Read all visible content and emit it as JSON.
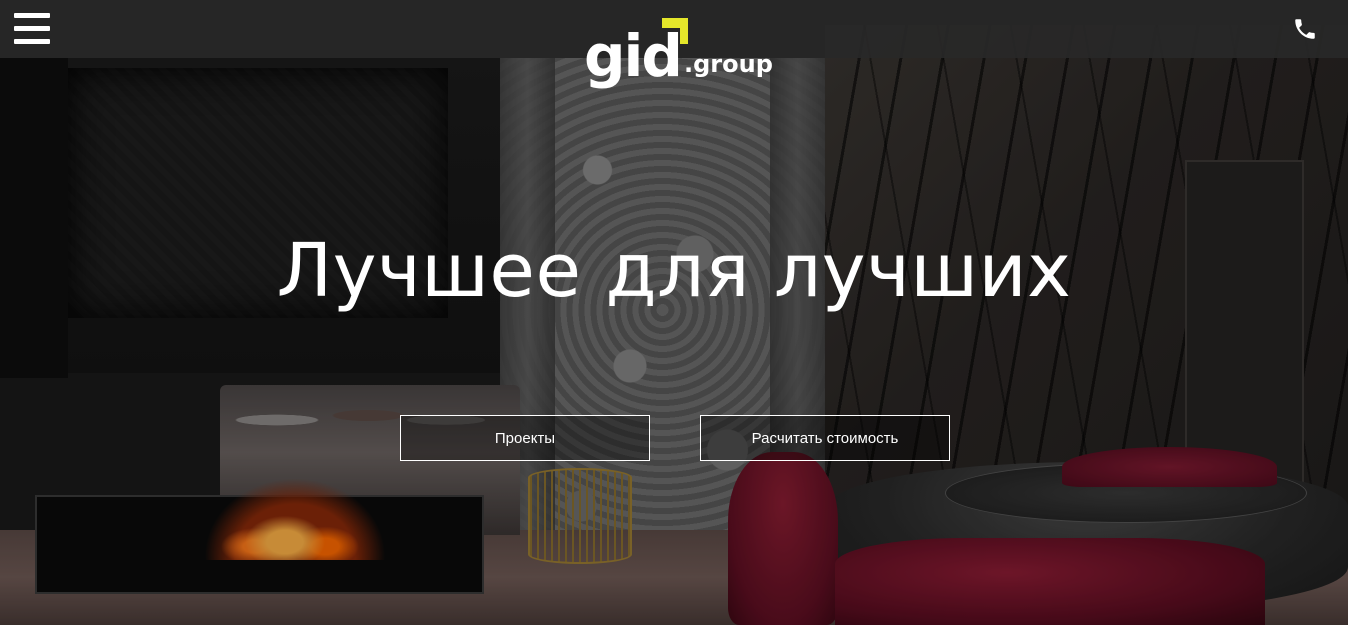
{
  "header": {
    "menu_icon": "hamburger-menu-icon",
    "logo": {
      "main": "gid",
      "suffix": ".group",
      "accent_color": "#e4e62a"
    },
    "phone_icon": "phone-icon"
  },
  "hero": {
    "title": "Лучшее для лучших",
    "buttons": [
      {
        "label": "Проекты"
      },
      {
        "label": "Расчитать стоимость"
      }
    ]
  },
  "colors": {
    "header_bg": "#282828",
    "text": "#ffffff",
    "button_border": "#ffffff"
  }
}
